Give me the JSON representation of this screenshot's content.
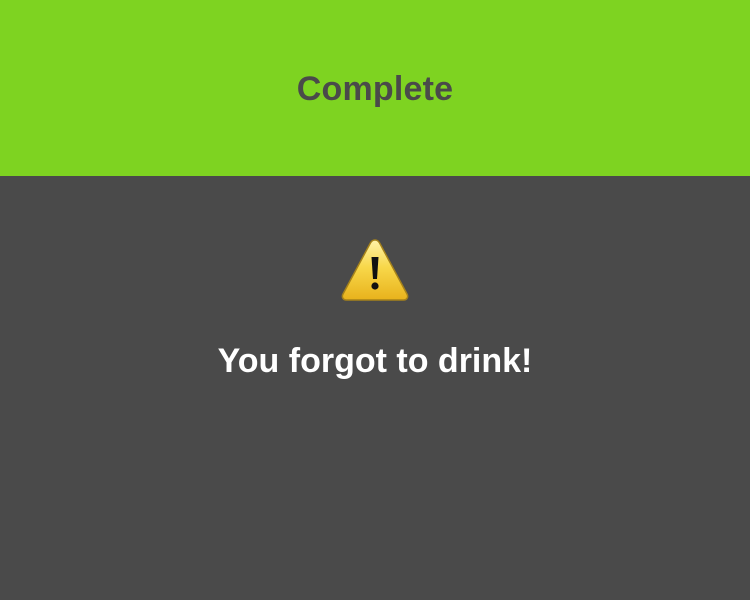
{
  "header": {
    "title": "Complete",
    "background_color": "#7ed321",
    "title_color": "#4a4a4a"
  },
  "main": {
    "background_color": "#4a4a4a",
    "icon": "warning-icon",
    "message": "You forgot to drink!",
    "message_color": "#ffffff"
  }
}
